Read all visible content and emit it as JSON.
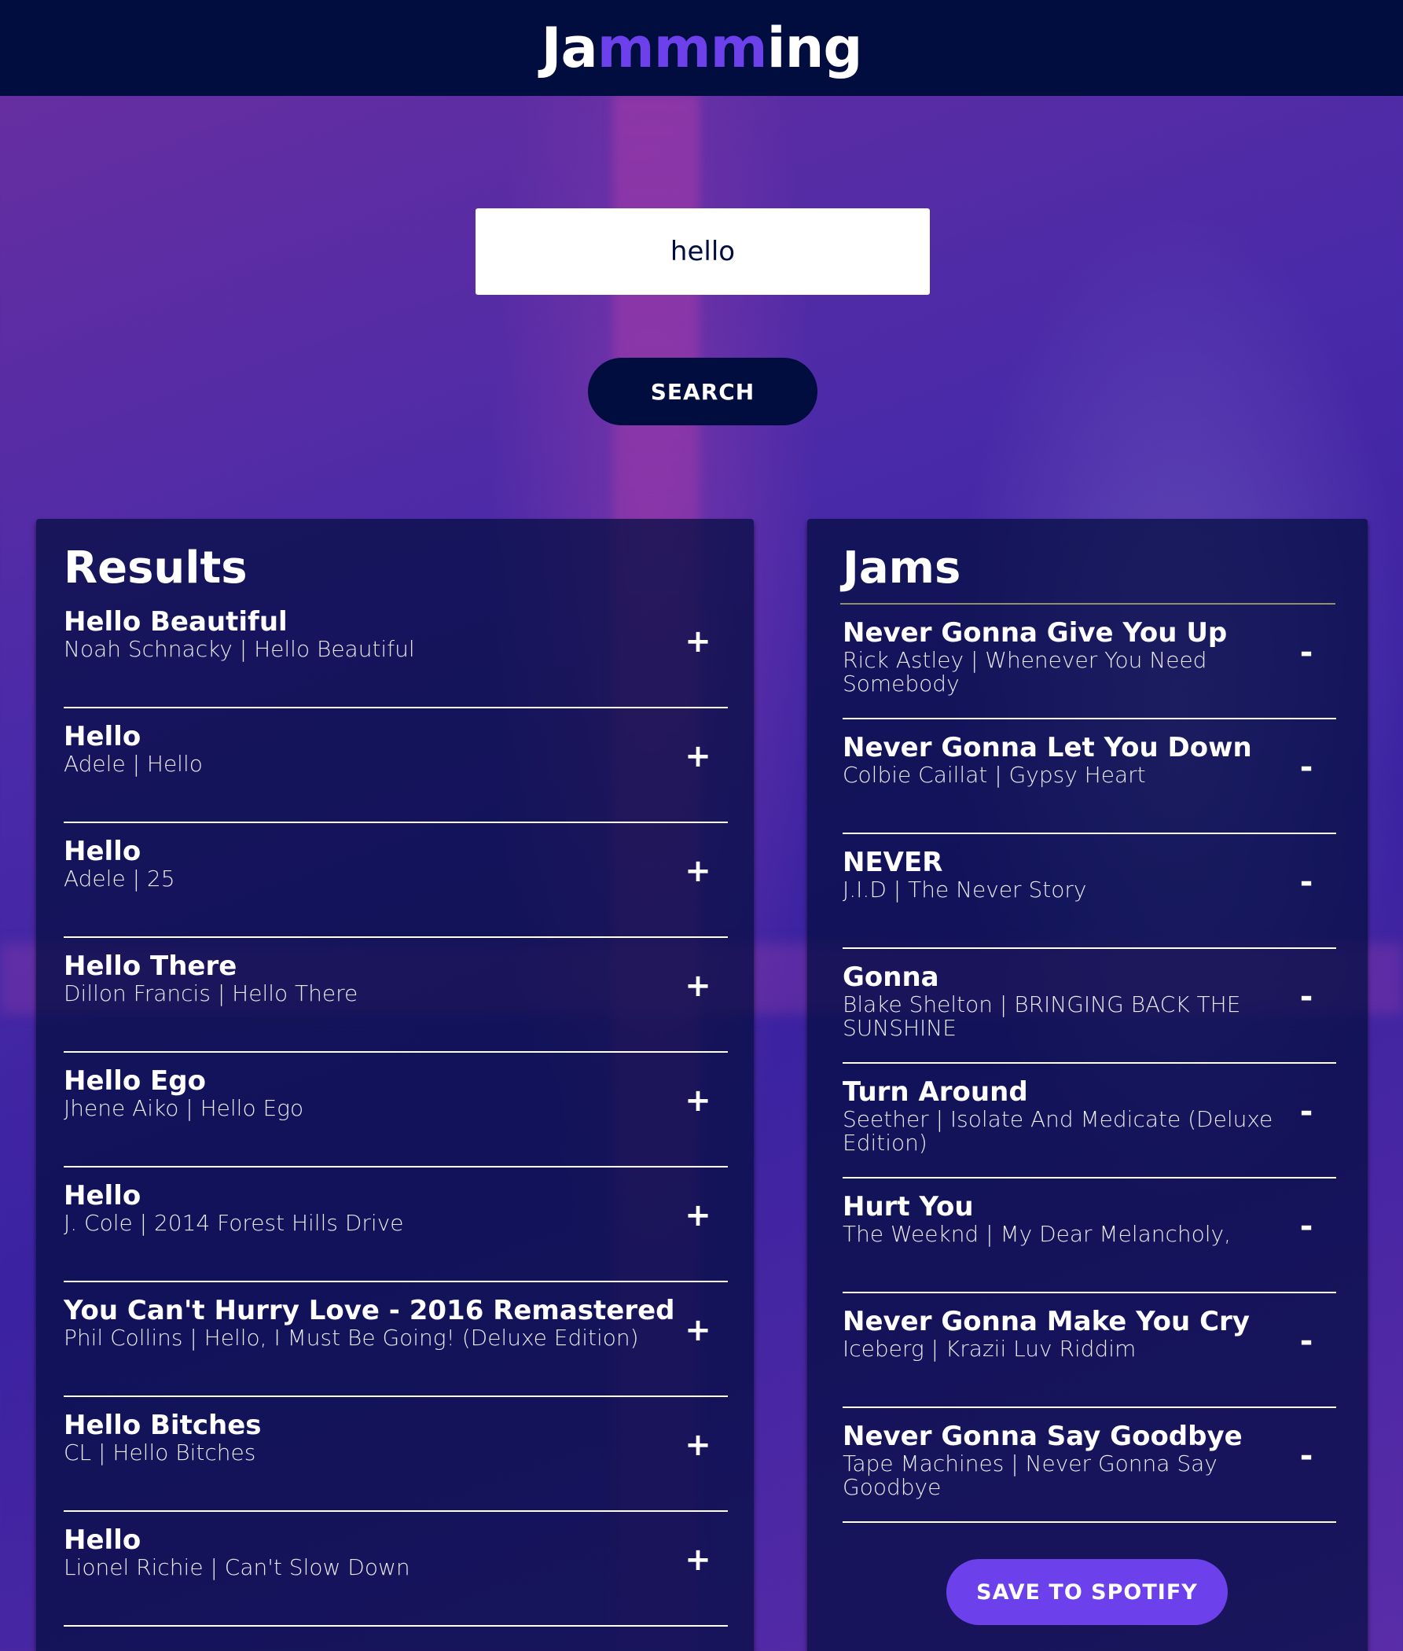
{
  "header": {
    "logo_part1": "Ja",
    "logo_part2": "mmm",
    "logo_part3": "ing"
  },
  "search": {
    "value": "hello",
    "button_label": "SEARCH"
  },
  "results": {
    "title": "Results",
    "add_symbol": "+",
    "tracks": [
      {
        "name": "Hello Beautiful",
        "meta": "Noah Schnacky | Hello Beautiful"
      },
      {
        "name": "Hello",
        "meta": "Adele | Hello"
      },
      {
        "name": "Hello",
        "meta": "Adele | 25"
      },
      {
        "name": "Hello There",
        "meta": "Dillon Francis | Hello There"
      },
      {
        "name": "Hello Ego",
        "meta": "Jhene Aiko | Hello Ego"
      },
      {
        "name": "Hello",
        "meta": "J. Cole | 2014 Forest Hills Drive"
      },
      {
        "name": "You Can't Hurry Love - 2016 Remastered",
        "meta": "Phil Collins | Hello, I Must Be Going! (Deluxe Edition)"
      },
      {
        "name": "Hello Bitches",
        "meta": "CL | Hello Bitches"
      },
      {
        "name": "Hello",
        "meta": "Lionel Richie | Can't Slow Down"
      }
    ]
  },
  "playlist": {
    "title": "Jams",
    "remove_symbol": "-",
    "save_label": "SAVE TO SPOTIFY",
    "tracks": [
      {
        "name": "Never Gonna Give You Up",
        "meta": "Rick Astley | Whenever You Need Somebody"
      },
      {
        "name": "Never Gonna Let You Down",
        "meta": "Colbie Caillat | Gypsy Heart"
      },
      {
        "name": "NEVER",
        "meta": "J.I.D | The Never Story"
      },
      {
        "name": "Gonna",
        "meta": "Blake Shelton | BRINGING BACK THE SUNSHINE"
      },
      {
        "name": "Turn Around",
        "meta": "Seether | Isolate And Medicate (Deluxe Edition)"
      },
      {
        "name": "Hurt You",
        "meta": "The Weeknd | My Dear Melancholy,"
      },
      {
        "name": "Never Gonna Make You Cry",
        "meta": "Iceberg | Krazii Luv Riddim"
      },
      {
        "name": "Never Gonna Say Goodbye",
        "meta": "Tape Machines | Never Gonna Say Goodbye"
      }
    ]
  }
}
